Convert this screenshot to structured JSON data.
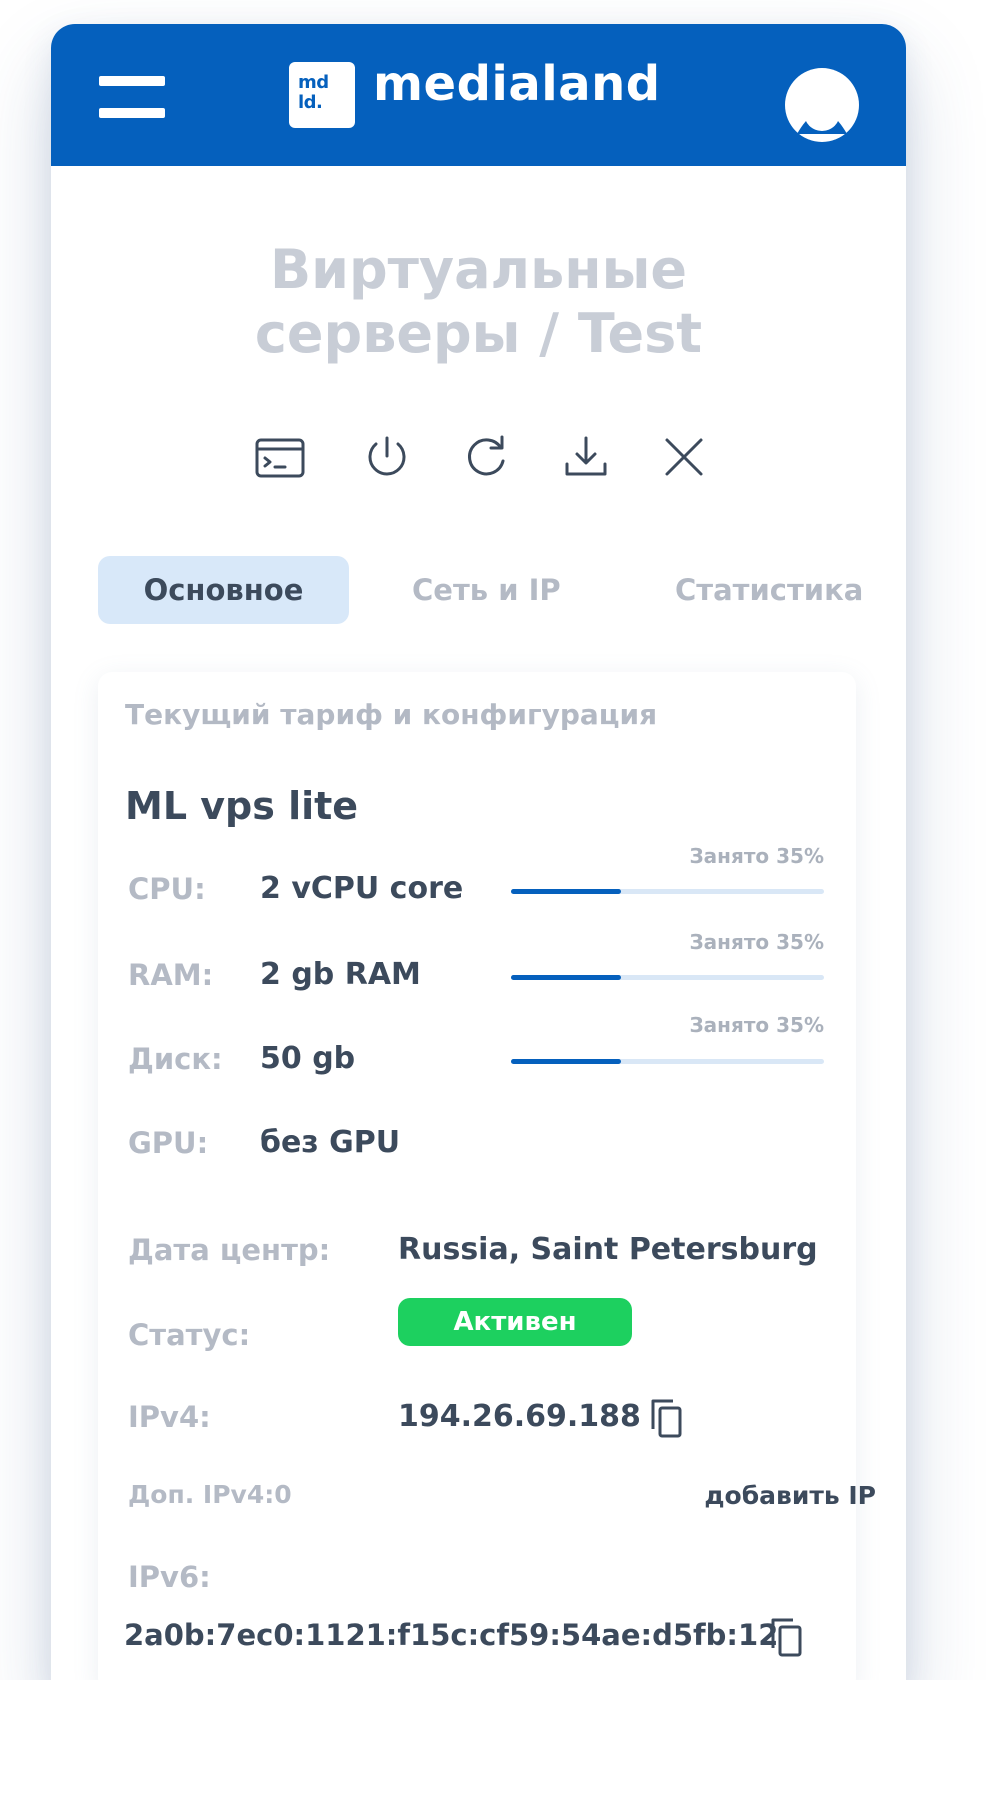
{
  "header": {
    "logo_mark_line1": "md",
    "logo_mark_line2": "ld.",
    "logo_text": "medialand"
  },
  "page": {
    "title": "Виртуальные серверы / Test"
  },
  "toolbar": {
    "icons": [
      "console-icon",
      "power-icon",
      "restart-icon",
      "download-icon",
      "close-icon"
    ]
  },
  "tabs": [
    {
      "label": "Основное",
      "active": true
    },
    {
      "label": "Сеть и IP",
      "active": false
    },
    {
      "label": "Статистика",
      "active": false
    }
  ],
  "card": {
    "title": "Текущий тариф и конфигурация",
    "plan_name": "ML vps lite",
    "resources": [
      {
        "label": "CPU:",
        "value": "2 vCPU core",
        "usage_text": "Занято 35%",
        "usage_fraction": 0.35
      },
      {
        "label": "RAM:",
        "value": "2 gb RAM",
        "usage_text": "Занято 35%",
        "usage_fraction": 0.35
      },
      {
        "label": "Диск:",
        "value": "50 gb",
        "usage_text": "Занято 35%",
        "usage_fraction": 0.35
      },
      {
        "label": "GPU:",
        "value": "без GPU"
      }
    ],
    "datacenter": {
      "label": "Дата центр:",
      "value": "Russia, Saint Petersburg"
    },
    "status": {
      "label": "Статус:",
      "value": "Активен",
      "color": "#1dd05f"
    },
    "ipv4": {
      "label": "IPv4:",
      "value": "194.26.69.188"
    },
    "extra_ipv4": {
      "label": "Доп. IPv4:0",
      "action": "добавить IP"
    },
    "ipv6": {
      "label": "IPv6:",
      "value": "2a0b:7ec0:1121:f15c:cf59:54ae:d5fb:12"
    }
  },
  "colors": {
    "brand": "#0560bd",
    "tab_active_bg": "#d8e8f9",
    "text_dark": "#3c4a5c",
    "text_muted": "#b4bac5"
  }
}
